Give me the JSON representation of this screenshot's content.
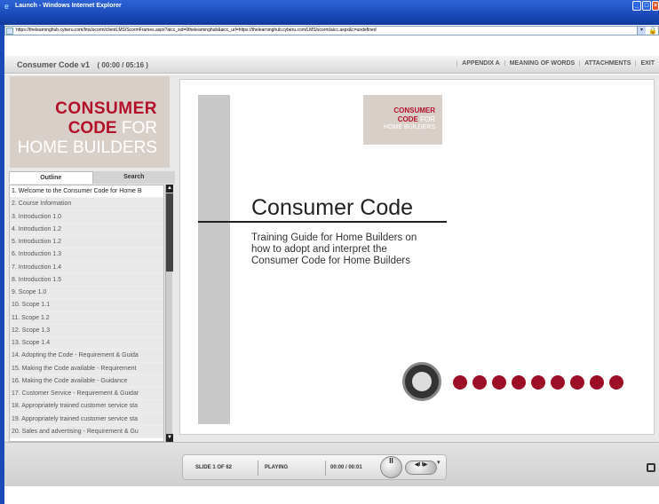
{
  "window": {
    "title": "Launch - Windows Internet Explorer",
    "url": "https://thelearninghub.cyberu.com/lms/scorm/clientLMS/ScormFrames.aspx?aicc_sid=0thelearninghub&aicc_url=https://thelearninghub.cyberu.com/LMS/scorm/aicc.aspx&c=undefined"
  },
  "header": {
    "course_title": "Consumer Code v1",
    "time": "( 00:00 / 05:16 )",
    "nav": [
      "APPENDIX A",
      "MEANING OF WORDS",
      "ATTACHMENTS",
      "EXIT"
    ]
  },
  "logo": {
    "line1": "CONSUMER",
    "line2a": "CODE",
    "line2b": " FOR",
    "line3": "HOME BUILDERS"
  },
  "tabs": {
    "outline": "Outline",
    "search": "Search"
  },
  "outline": [
    "1. Welcome to the Consumer Code for Home B",
    "2. Course Information",
    "3. Introduction 1.0",
    "4. Introduction 1.2",
    "5. Introduction 1.2",
    "6. Introduction 1.3",
    "7. Introduction 1.4",
    "8. Introduction 1.5",
    "9. Scope 1.0",
    "10. Scope 1.1",
    "11. Scope 1.2",
    "12. Scope 1.3",
    "13. Scope 1.4",
    "14. Adopting the Code - Requirement & Guida",
    "15. Making the Code available - Requirement",
    "16. Making the Code available - Guidance",
    "17. Customer Service - Requirement & Guidar",
    "18. Appropriately trained customer service sta",
    "19. Appropriately trained customer service sta",
    "20. Sales and advertising - Requirement & Gu"
  ],
  "slide": {
    "title": "Consumer Code",
    "subtitle": "Training Guide for Home Builders on how to adopt and interpret the Consumer Code for Home Builders",
    "dot_count": 9
  },
  "controls": {
    "slide_counter": "SLIDE 1 OF 62",
    "status": "PLAYING",
    "timecode": "00:00 / 00:01",
    "pause_symbol": "II",
    "step_symbols": "◀I I▶",
    "fullscreen_symbol": "⛶"
  },
  "colors": {
    "brand_red": "#b3102a",
    "dot_red": "#9d0f26",
    "titlebar_blue": "#1b4ab8"
  }
}
